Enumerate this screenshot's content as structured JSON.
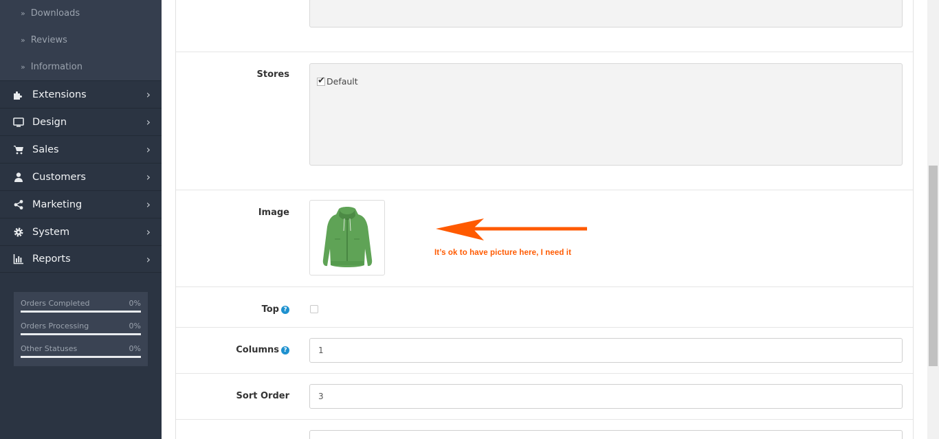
{
  "sidebar": {
    "sub_items": [
      {
        "label": "Downloads"
      },
      {
        "label": "Reviews"
      },
      {
        "label": "Information"
      }
    ],
    "menu": [
      {
        "label": "Extensions",
        "icon": "puzzle-icon"
      },
      {
        "label": "Design",
        "icon": "monitor-icon"
      },
      {
        "label": "Sales",
        "icon": "cart-icon"
      },
      {
        "label": "Customers",
        "icon": "user-icon"
      },
      {
        "label": "Marketing",
        "icon": "share-icon"
      },
      {
        "label": "System",
        "icon": "gear-icon"
      },
      {
        "label": "Reports",
        "icon": "bar-chart-icon"
      }
    ],
    "stats": [
      {
        "label": "Orders Completed",
        "value": "0%"
      },
      {
        "label": "Orders Processing",
        "value": "0%"
      },
      {
        "label": "Other Statuses",
        "value": "0%"
      }
    ]
  },
  "form": {
    "stores": {
      "label": "Stores",
      "option": "Default",
      "checked": true
    },
    "image": {
      "label": "Image",
      "annotation": "It’s ok to have picture here, I need it"
    },
    "top": {
      "label": "Top",
      "checked": false
    },
    "columns": {
      "label": "Columns",
      "value": "1"
    },
    "sort_order": {
      "label": "Sort Order",
      "value": "3"
    }
  },
  "colors": {
    "sidebar_bg": "#2b3442",
    "submenu_bg": "#353e4e",
    "annotation": "#ff5a00",
    "help_badge": "#1e91cf"
  }
}
